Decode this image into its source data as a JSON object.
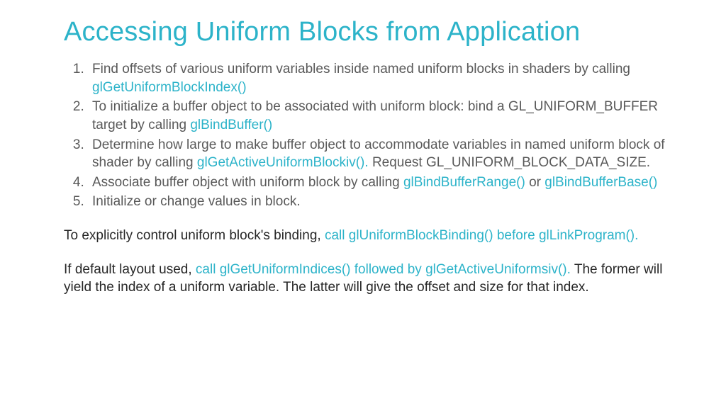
{
  "title": "Accessing Uniform Blocks from Application",
  "api": {
    "getUniformBlockIndex": "glGetUniformBlockIndex()",
    "bindBuffer": "glBindBuffer()",
    "getActiveUniformBlockiv": "glGetActiveUniformBlockiv(). ",
    "bindBufferRange": "glBindBufferRange()",
    "bindBufferBase": "glBindBufferBase()",
    "uniformBlockBindingCall": "call glUniformBlockBinding() before glLinkProgram().",
    "uniformIndicesCall": "call glGetUniformIndices() followed by glGetActiveUniformsiv().  "
  },
  "step1": "Find offsets of various uniform variables inside named uniform blocks in shaders by calling ",
  "step2a": "To initialize a buffer object to be associated with uniform block:  bind a GL_UNIFORM_BUFFER target by calling ",
  "step3a": "Determine how large to make buffer object to accommodate variables in named uniform block of shader by calling ",
  "step3b": "Request GL_UNIFORM_BLOCK_DATA_SIZE.",
  "step4a": "Associate buffer object with uniform block by calling ",
  "step4b": " or ",
  "step5": "Initialize or change values in block.",
  "p1_bold": "To explicitly control uniform block's binding, ",
  "p2_bold": "If default layout used, ",
  "p2_rest": "The former will yield the index of a uniform variable.  The latter will give the offset and size for that index."
}
